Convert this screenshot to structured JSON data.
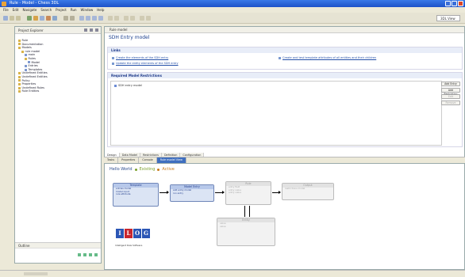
{
  "window": {
    "title": "Rule - Model - Chess 3DL"
  },
  "menubar": [
    "File",
    "Edit",
    "Navigate",
    "Search",
    "Project",
    "Run",
    "Window",
    "Help"
  ],
  "toolbar": {
    "perspective": "3DL View"
  },
  "explorer": {
    "tab": "Project Explorer",
    "tree": [
      "Rule",
      "Documentation",
      "Models",
      "rule model",
      "main",
      "Rules",
      "Model",
      "Entries",
      "Templates",
      "Undefined Entities",
      "Undefined Entities",
      "Policy",
      "Properties",
      "Undefined Rules",
      "Rule Entities"
    ],
    "bottom_tab": "Outline"
  },
  "editor": {
    "tab": "Rule model",
    "title": "SDH Entry model",
    "links": {
      "heading": "Links",
      "items": [
        "Create the elements of the SDH entry",
        "Update the entity elements of the SDH entry",
        "Create and test template attributes of all entities and their children"
      ]
    },
    "requirements": {
      "heading": "Required Model Restrictions",
      "items": [
        "SDH entry model"
      ],
      "buttons": [
        "Add Entry",
        "Add Restriction",
        "Edit",
        "Remove"
      ]
    },
    "editor_tabs": [
      "Design",
      "Data Model",
      "Restrictions",
      "Definition",
      "Configuration"
    ]
  },
  "views": {
    "tabs": [
      "Tasks",
      "Properties",
      "Console",
      "Rule model View"
    ],
    "active_tab": "Rule model View"
  },
  "diagram": {
    "title": "Hello World",
    "legend": [
      "Existing",
      "Active"
    ],
    "boxes": [
      {
        "title": "Template",
        "rows": [
          "entries model",
          "model input",
          "rule attribute"
        ]
      },
      {
        "title": "Model Entry",
        "rows": [
          "add entry model",
          "run entry"
        ]
      },
      {
        "title": "Rule",
        "rows": [
          "entry field",
          "entry value",
          "entry value"
        ]
      },
      {
        "title": "Output",
        "rows": [
          "restrictions model"
        ]
      },
      {
        "title": "Entity",
        "rows": [
          "value",
          "value"
        ]
      }
    ],
    "logo_letters": [
      "I",
      "L",
      "O",
      "G"
    ],
    "logo_caption": "Intelligent Rule Software"
  }
}
